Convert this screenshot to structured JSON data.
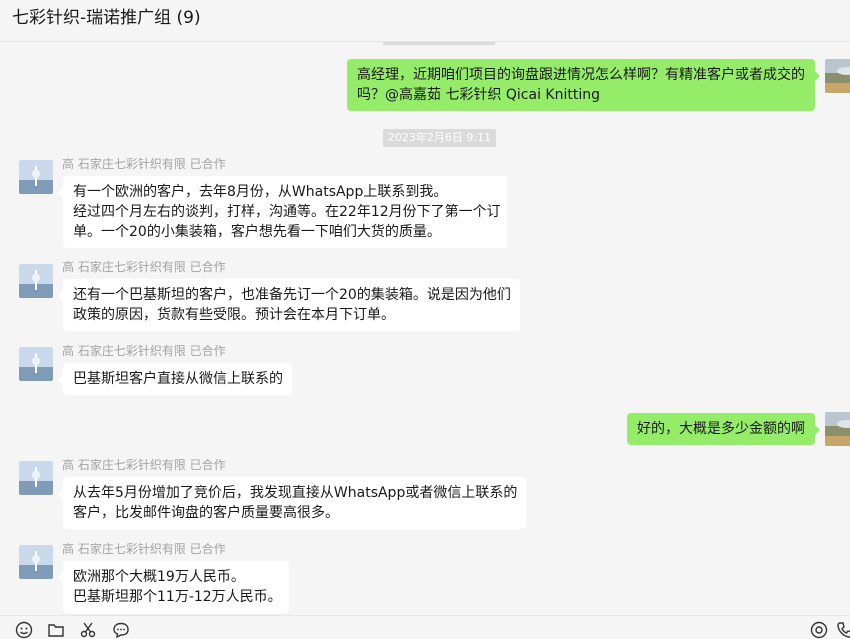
{
  "window": {
    "title": "七彩针织-瑞诺推广组 (9)"
  },
  "timestamp": "2023年2月6日 9:11",
  "messages": [
    {
      "from": "self",
      "lines": [
        "高经理，近期咱们项目的询盘跟进情况怎么样啊？有精准客户或者成交的",
        "吗？@高嘉茹 七彩针织 Qicai Knitting"
      ]
    },
    {
      "from": "other",
      "sender": "高 石家庄七彩针织有限 已合作",
      "lines": [
        "有一个欧洲的客户，去年8月份，从WhatsApp上联系到我。",
        "经过四个月左右的谈判，打样，沟通等。在22年12月份下了第一个订",
        "单。一个20的小集装箱，客户想先看一下咱们大货的质量。"
      ]
    },
    {
      "from": "other",
      "sender": "高 石家庄七彩针织有限 已合作",
      "lines": [
        "还有一个巴基斯坦的客户，也准备先订一个20的集装箱。说是因为他们",
        "政策的原因，货款有些受限。预计会在本月下订单。"
      ]
    },
    {
      "from": "other",
      "sender": "高 石家庄七彩针织有限 已合作",
      "lines": [
        "巴基斯坦客户直接从微信上联系的"
      ]
    },
    {
      "from": "self",
      "lines": [
        "好的，大概是多少金额的啊"
      ]
    },
    {
      "from": "other",
      "sender": "高 石家庄七彩针织有限 已合作",
      "lines": [
        "从去年5月份增加了竞价后，我发现直接从WhatsApp或者微信上联系的",
        "客户，比发邮件询盘的客户质量要高很多。"
      ]
    },
    {
      "from": "other",
      "sender": "高 石家庄七彩针织有限 已合作",
      "lines": [
        "欧洲那个大概19万人民币。",
        "巴基斯坦那个11万-12万人民币。"
      ]
    }
  ],
  "toolbar": {
    "icons": [
      "emoji-icon",
      "folder-icon",
      "scissors-icon",
      "chat-bubble-icon",
      "target-icon",
      "phone-icon"
    ]
  },
  "colors": {
    "background": "#f5f5f5",
    "self_bubble": "#95ec69",
    "other_bubble": "#ffffff",
    "sender_name": "#a3a3a3",
    "timestamp_badge": "#dadada"
  }
}
